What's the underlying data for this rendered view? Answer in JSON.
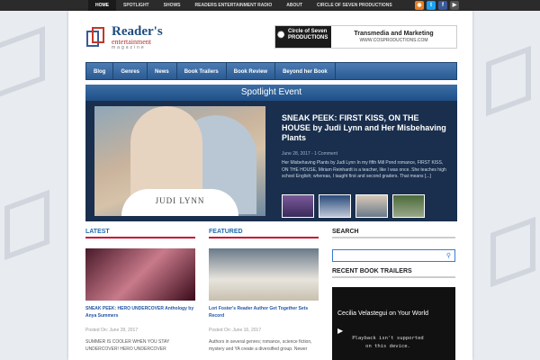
{
  "topnav": {
    "items": [
      "HOME",
      "SPOTLIGHT",
      "SHOWS",
      "READERS ENTERTAINMENT RADIO",
      "ABOUT",
      "CIRCLE OF SEVEN PRODUCTIONS"
    ]
  },
  "social": {
    "icons": [
      "rss-icon",
      "twitter-icon",
      "facebook-icon",
      "youtube-icon"
    ]
  },
  "logo": {
    "line1": "Reader's",
    "line2": "entertainment",
    "line3": "magazine"
  },
  "banner": {
    "left": "Circle of Seven PRODUCTIONS",
    "right": "Transmedia and Marketing",
    "url": "WWW.COSPRODUCTIONS.COM"
  },
  "mainnav": {
    "items": [
      "Blog",
      "Genres",
      "News",
      "Book Trailers",
      "Book Review",
      "Beyond her Book"
    ]
  },
  "spotlight": {
    "header": "Spotlight Event",
    "author_on_image": "JUDI LYNN",
    "title": "SNEAK PEEK: FIRST KISS, ON THE HOUSE by Judi Lynn and Her Misbehaving Plants",
    "meta": "June 28, 2017 - 1 Comment",
    "excerpt": "Her Misbehaving Plants by Judi Lynn In my fifth Mill Pond romance, FIRST KISS, ON THE HOUSE, Miriam Reinhardt is a teacher, like I was once. She teaches high school English; whereas, I taught first and second graders. That means [...]"
  },
  "latest": {
    "heading": "LATEST",
    "title": "SNEAK PEEK: HERO UNDERCOVER Anthology by Anya Summers",
    "meta": "Posted On: June 28, 2017",
    "text": "SUMMER IS COOLER WHEN YOU STAY UNDERCOVER! HERO UNDERCOVER"
  },
  "featured": {
    "heading": "FEATURED",
    "title": "Lori Foster's Reader Author Get Together Sets Record",
    "meta": "Posted On: June 16, 2017",
    "text": "Authors in several genres; romance, science fiction, mystery and YA create a diversified group. Newer"
  },
  "sidebar": {
    "search_heading": "SEARCH",
    "trailers_heading": "RECENT BOOK TRAILERS",
    "video_title": "Cecilia Velastegui on Your World",
    "video_msg": "Playback isn't supported on this device."
  }
}
